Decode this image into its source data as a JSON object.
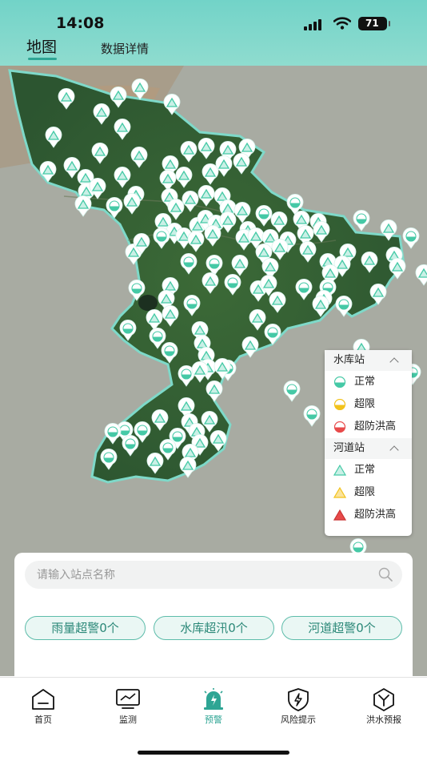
{
  "status_bar": {
    "time": "14:08",
    "battery": "71"
  },
  "tabs": [
    {
      "label": "地图",
      "active": true
    },
    {
      "label": "数据详情",
      "active": false
    }
  ],
  "legend": {
    "reservoir": {
      "title": "水库站",
      "items": [
        {
          "label": "正常",
          "color": "#45c9a6"
        },
        {
          "label": "超限",
          "color": "#f2c21b"
        },
        {
          "label": "超防洪高",
          "color": "#e84a4a"
        }
      ]
    },
    "river": {
      "title": "河道站",
      "items": [
        {
          "label": "正常",
          "color": "#45c9a6"
        },
        {
          "label": "超限",
          "color": "#f2c21b"
        },
        {
          "label": "超防洪高",
          "color": "#e84a4a"
        }
      ]
    }
  },
  "search": {
    "placeholder": "请输入站点名称",
    "value": ""
  },
  "alert_chips": [
    {
      "label": "雨量超警0个"
    },
    {
      "label": "水库超汛0个"
    },
    {
      "label": "河道超警0个"
    }
  ],
  "bottom_nav": [
    {
      "label": "首页",
      "icon": "home-icon",
      "active": false
    },
    {
      "label": "监测",
      "icon": "monitor-icon",
      "active": false
    },
    {
      "label": "预警",
      "icon": "alarm-icon",
      "active": true
    },
    {
      "label": "风险提示",
      "icon": "shield-bolt-icon",
      "active": false
    },
    {
      "label": "洪水预报",
      "icon": "forecast-icon",
      "active": false
    }
  ],
  "colors": {
    "accent": "#2ea594",
    "marker": "#45c9a6",
    "header": "#7fd8cc"
  }
}
